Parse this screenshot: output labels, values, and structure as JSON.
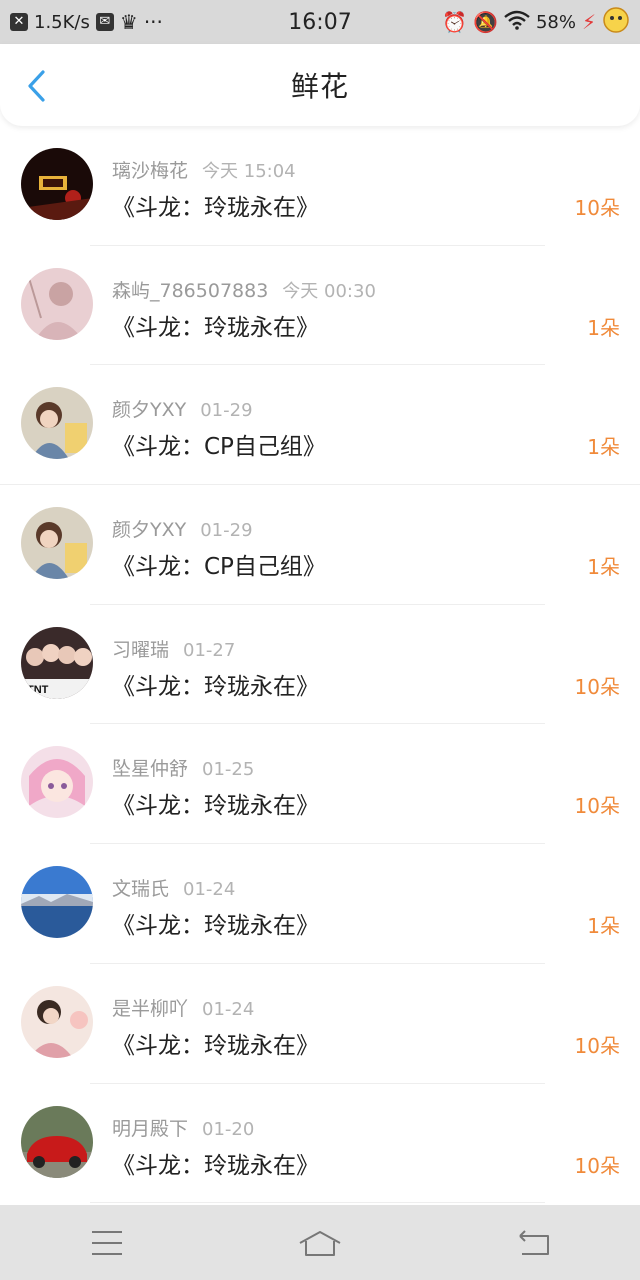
{
  "status_bar": {
    "speed": "1.5K/s",
    "time": "16:07",
    "battery": "58%",
    "icons": [
      "close-notification-icon",
      "mail-icon",
      "crown-icon",
      "more-icon",
      "alarm-icon",
      "mute-icon",
      "wifi-icon",
      "charging-icon",
      "app-icon"
    ]
  },
  "header": {
    "title": "鲜花",
    "back_icon": "chevron-left-icon"
  },
  "colors": {
    "accent_blue": "#3aa0e8",
    "count_orange": "#f08a3a",
    "meta_gray": "#9a9a9a"
  },
  "records": [
    {
      "name": "璃沙梅花",
      "time": "今天 15:04",
      "gift": "《斗龙：玲珑永在》",
      "count": "10朵"
    },
    {
      "name": "森屿_786507883",
      "time": "今天 00:30",
      "gift": "《斗龙：玲珑永在》",
      "count": "1朵"
    },
    {
      "name": "颜夕YXY",
      "time": "01-29",
      "gift": "《斗龙：CP自己组》",
      "count": "1朵"
    },
    {
      "name": "颜夕YXY",
      "time": "01-29",
      "gift": "《斗龙：CP自己组》",
      "count": "1朵"
    },
    {
      "name": "习曜瑞",
      "time": "01-27",
      "gift": "《斗龙：玲珑永在》",
      "count": "10朵"
    },
    {
      "name": "坠星仲舒",
      "time": "01-25",
      "gift": "《斗龙：玲珑永在》",
      "count": "10朵"
    },
    {
      "name": "文瑞氏",
      "time": "01-24",
      "gift": "《斗龙：玲珑永在》",
      "count": "1朵"
    },
    {
      "name": "是半柳吖",
      "time": "01-24",
      "gift": "《斗龙：玲珑永在》",
      "count": "10朵"
    },
    {
      "name": "明月殿下",
      "time": "01-20",
      "gift": "《斗龙：玲珑永在》",
      "count": "10朵"
    }
  ],
  "nav_bar": {
    "icons": [
      "menu-icon",
      "home-icon",
      "back-icon"
    ]
  }
}
